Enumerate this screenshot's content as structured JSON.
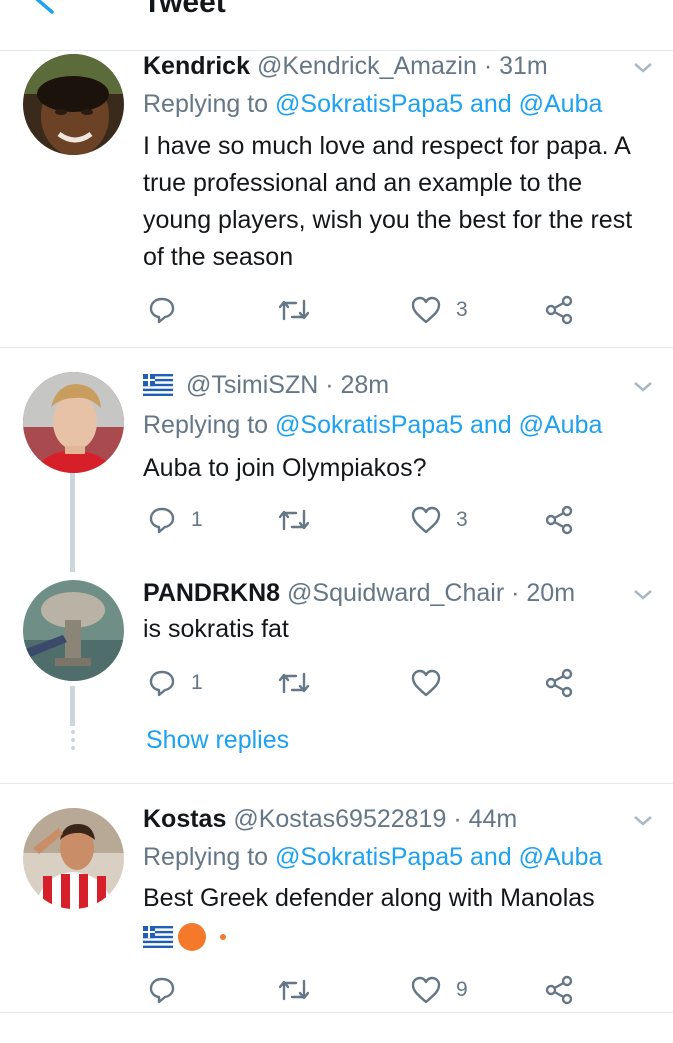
{
  "header": {
    "title": "Tweet"
  },
  "tweets": [
    {
      "name": "Kendrick",
      "handle": "@Kendrick_Amazin",
      "time": "31m",
      "replying_prefix": "Replying to",
      "replying_to": "@SokratisPapa5 and @Auba",
      "text": "I have so much love and respect for papa. A true professional and an example to the young players, wish you the best for the rest of the season",
      "replies": "",
      "retweets": "",
      "likes": "3"
    },
    {
      "name": "",
      "handle": "@TsimiSZN",
      "time": "28m",
      "replying_prefix": "Replying to",
      "replying_to": "@SokratisPapa5 and @Auba",
      "text": "Auba to join Olympiakos?",
      "replies": "1",
      "retweets": "",
      "likes": "3"
    },
    {
      "name": "PANDRKN8",
      "handle": "@Squidward_Chair",
      "time": "20m",
      "text": "is sokratis fat",
      "replies": "1",
      "retweets": "",
      "likes": ""
    },
    {
      "name": "Kostas",
      "handle": "@Kostas69522819",
      "time": "44m",
      "replying_prefix": "Replying to",
      "replying_to": "@SokratisPapa5 and @Auba",
      "text": "Best Greek defender along with Manolas",
      "replies": "",
      "retweets": "",
      "likes": "9"
    }
  ],
  "show_replies": "Show replies",
  "icons": [
    "back-arrow-icon",
    "chevron-down-icon",
    "reply-icon",
    "retweet-icon",
    "like-icon",
    "share-icon",
    "greek-flag-icon",
    "orange-circle-emoji-icon"
  ],
  "colors": {
    "link": "#1da1f2",
    "muted": "#657786",
    "text": "#14171a",
    "divider": "#e1e8ed",
    "thread": "#ccd6dd"
  }
}
